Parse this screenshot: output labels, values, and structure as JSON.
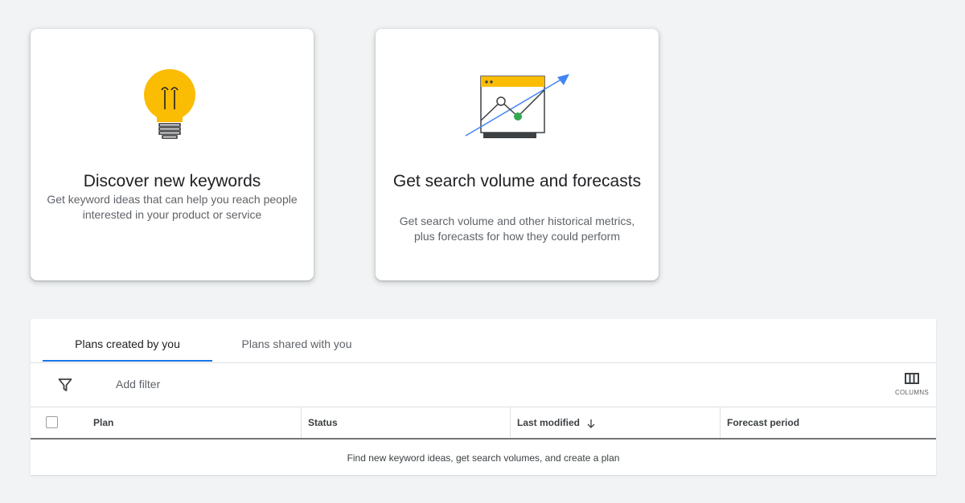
{
  "cards": [
    {
      "title": "Discover new keywords",
      "description": "Get keyword ideas that can help you reach people interested in your product or service",
      "icon": "lightbulb-icon"
    },
    {
      "title": "Get search volume and forecasts",
      "description": "Get search volume and other historical metrics, plus forecasts for how they could perform",
      "icon": "forecast-chart-icon"
    }
  ],
  "tabs": [
    {
      "label": "Plans created by you",
      "active": true
    },
    {
      "label": "Plans shared with you",
      "active": false
    }
  ],
  "filter": {
    "label": "Add filter",
    "icon": "filter-icon"
  },
  "columns_button": {
    "label": "COLUMNS",
    "icon": "columns-icon"
  },
  "table": {
    "columns": [
      "Plan",
      "Status",
      "Last modified",
      "Forecast period"
    ],
    "sorted_column": "Last modified",
    "sort_direction": "descending",
    "empty_message": "Find new keyword ideas, get search volumes, and create a plan"
  },
  "colors": {
    "accent_blue": "#1a73e8",
    "bulb_yellow": "#fbbc04",
    "green_point": "#34a853",
    "arrow_blue": "#4285f4"
  }
}
